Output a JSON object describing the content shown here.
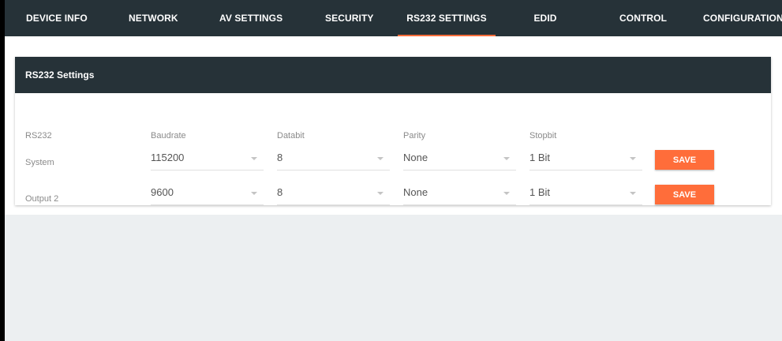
{
  "nav": {
    "tabs": [
      {
        "label": "DEVICE INFO"
      },
      {
        "label": "NETWORK"
      },
      {
        "label": "AV SETTINGS"
      },
      {
        "label": "SECURITY"
      },
      {
        "label": "RS232 SETTINGS"
      },
      {
        "label": "EDID"
      },
      {
        "label": "CONTROL"
      },
      {
        "label": "CONFIGURATION"
      }
    ],
    "active_tab": "RS232 SETTINGS",
    "accent_color": "#ff6d3a",
    "background_color": "#263238"
  },
  "card": {
    "title": "RS232 Settings",
    "columns": {
      "rs232": "RS232",
      "baudrate": "Baudrate",
      "databit": "Databit",
      "parity": "Parity",
      "stopbit": "Stopbit"
    },
    "rows": [
      {
        "name": "System",
        "baudrate": "115200",
        "databit": "8",
        "parity": "None",
        "stopbit": "1 Bit",
        "save_label": "SAVE"
      },
      {
        "name": "Output 2",
        "baudrate": "9600",
        "databit": "8",
        "parity": "None",
        "stopbit": "1 Bit",
        "save_label": "SAVE"
      }
    ]
  },
  "icons": {
    "dropdown": "chevron-down-icon"
  }
}
